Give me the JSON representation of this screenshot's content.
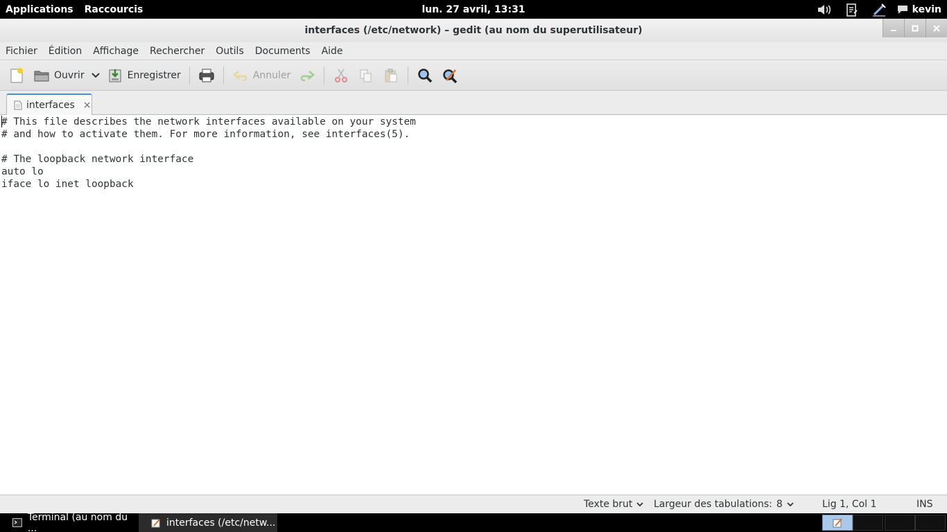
{
  "top_panel": {
    "applications": "Applications",
    "shortcuts": "Raccourcis",
    "clock": "lun. 27 avril, 13:31",
    "user": "kevin"
  },
  "window": {
    "title": "interfaces (/etc/network) – gedit (au nom du superutilisateur)"
  },
  "menubar": [
    "Fichier",
    "Édition",
    "Affichage",
    "Rechercher",
    "Outils",
    "Documents",
    "Aide"
  ],
  "toolbar": {
    "open_label": "Ouvrir",
    "save_label": "Enregistrer",
    "undo_label": "Annuler"
  },
  "tab": {
    "label": "interfaces",
    "close": "×"
  },
  "editor": {
    "lines": [
      "# This file describes the network interfaces available on your system",
      "# and how to activate them. For more information, see interfaces(5).",
      "",
      "# The loopback network interface",
      "auto lo",
      "iface lo inet loopback"
    ]
  },
  "statusbar": {
    "language": "Texte brut",
    "tab_width_label": "Largeur des tabulations:",
    "tab_width_value": "8",
    "position": "Lig 1, Col 1",
    "mode": "INS"
  },
  "taskbar": {
    "tasks": [
      "Terminal (au nom du ...",
      "interfaces (/etc/netw..."
    ]
  },
  "colors": {
    "panel": "#000000",
    "tab_accent": "#4a90d9",
    "workspace_active": "#a9c8ea"
  }
}
